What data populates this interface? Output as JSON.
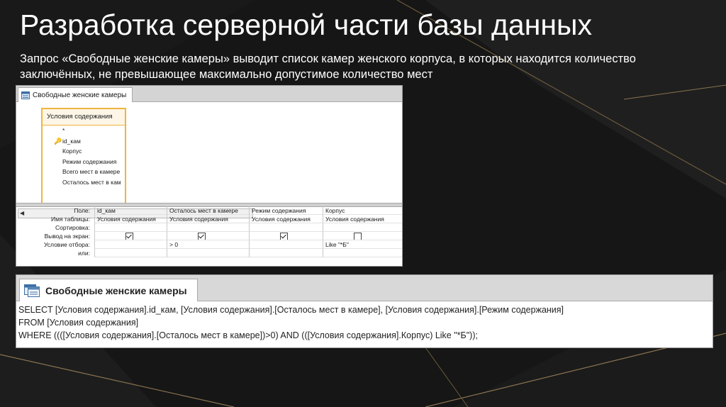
{
  "slide": {
    "title": "Разработка серверной части базы данных",
    "subtitle": "Запрос «Свободные женские камеры» выводит список камер женского корпуса, в которых находится количество заключённых, не превышающее максимально допустимое количество мест"
  },
  "query_designer": {
    "tab_label": "Свободные женские камеры",
    "table_box": {
      "title": "Условия содержания",
      "fields": [
        "*",
        "id_кам",
        "Корпус",
        "Режим содержания",
        "Всего мест в камере",
        "Осталось мест в кам"
      ]
    },
    "grid": {
      "row_labels": [
        "Поле:",
        "Имя таблицы:",
        "Сортировка:",
        "Вывод на экран:",
        "Условие отбора:",
        "или:"
      ],
      "columns": [
        {
          "field": "id_кам",
          "table": "Условия содержания",
          "sort": "",
          "show": true,
          "criteria": "",
          "or": ""
        },
        {
          "field": "Осталось мест в камере",
          "table": "Условия содержания",
          "sort": "",
          "show": true,
          "criteria": "> 0",
          "or": ""
        },
        {
          "field": "Режим содержания",
          "table": "Условия содержания",
          "sort": "",
          "show": true,
          "criteria": "",
          "or": ""
        },
        {
          "field": "Корпус",
          "table": "Условия содержания",
          "sort": "",
          "show": false,
          "criteria": "Like \"*Б\"",
          "or": ""
        }
      ]
    }
  },
  "sql_view": {
    "tab_label": "Свободные женские камеры",
    "lines": [
      "SELECT [Условия содержания].id_кам, [Условия содержания].[Осталось мест в камере], [Условия содержания].[Режим содержания]",
      "FROM [Условия содержания]",
      "WHERE ((([Условия содержания].[Осталось мест в камере])>0) AND (([Условия содержания].Корпус) Like \"*Б\"));"
    ]
  },
  "colors": {
    "table_border": "#f0b43c",
    "background": "#141414",
    "text_on_dark": "#ffffff"
  }
}
